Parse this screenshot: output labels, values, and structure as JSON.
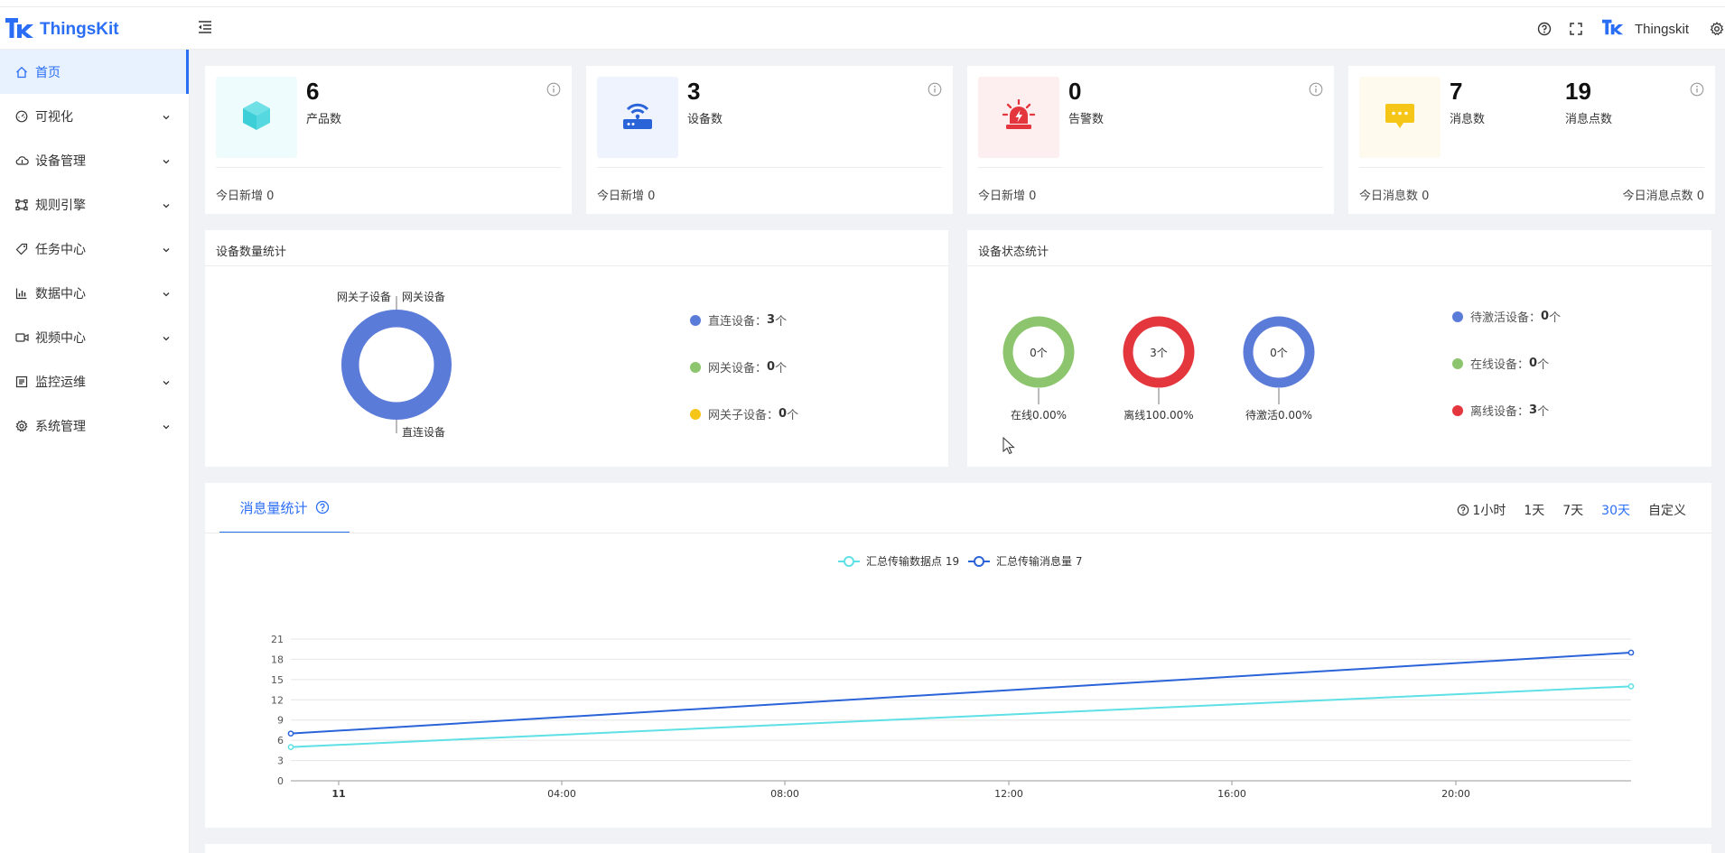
{
  "app": {
    "logo_text": "ThingsKit"
  },
  "header": {
    "user_name": "Thingskit"
  },
  "sidebar": {
    "items": [
      {
        "label": "首页",
        "icon": "home-icon"
      },
      {
        "label": "可视化",
        "icon": "dashboard-icon"
      },
      {
        "label": "设备管理",
        "icon": "cloud-icon"
      },
      {
        "label": "规则引擎",
        "icon": "flow-icon"
      },
      {
        "label": "任务中心",
        "icon": "tag-icon"
      },
      {
        "label": "数据中心",
        "icon": "bar-chart-icon"
      },
      {
        "label": "视频中心",
        "icon": "video-icon"
      },
      {
        "label": "监控运维",
        "icon": "monitor-icon"
      },
      {
        "label": "系统管理",
        "icon": "gear-icon"
      }
    ]
  },
  "stats": {
    "products": {
      "value": "6",
      "label": "产品数",
      "foot": "今日新增 0",
      "color": "#eefcfd"
    },
    "devices": {
      "value": "3",
      "label": "设备数",
      "foot": "今日新增 0",
      "color": "#eef3fe"
    },
    "alarms": {
      "value": "0",
      "label": "告警数",
      "foot": "今日新增 0",
      "color": "#fdeff0"
    },
    "messages": {
      "value": "7",
      "label": "消息数",
      "value2": "19",
      "label2": "消息点数",
      "foot": "今日消息数 0",
      "foot2": "今日消息点数 0",
      "color": "#fefaee"
    }
  },
  "device_count": {
    "title": "设备数量统计",
    "donut_labels": {
      "gateway_sub": "网关子设备",
      "gateway": "网关设备",
      "direct": "直连设备"
    },
    "legend": [
      {
        "name": "直连设备：",
        "value": "3",
        "unit": "个",
        "color": "#5b7bd9"
      },
      {
        "name": "网关设备：",
        "value": "0",
        "unit": "个",
        "color": "#8cc56d"
      },
      {
        "name": "网关子设备：",
        "value": "0",
        "unit": "个",
        "color": "#f5c518"
      }
    ]
  },
  "device_status": {
    "title": "设备状态统计",
    "gauges": [
      {
        "center": "0个",
        "caption": "在线0.00%",
        "color": "#8cc56d"
      },
      {
        "center": "3个",
        "caption": "离线100.00%",
        "color": "#e3363d"
      },
      {
        "center": "0个",
        "caption": "待激活0.00%",
        "color": "#5b7bd9"
      }
    ],
    "legend": [
      {
        "name": "待激活设备：",
        "value": "0",
        "unit": "个",
        "color": "#5b7bd9"
      },
      {
        "name": "在线设备：",
        "value": "0",
        "unit": "个",
        "color": "#8cc56d"
      },
      {
        "name": "离线设备：",
        "value": "3",
        "unit": "个",
        "color": "#e3363d"
      }
    ]
  },
  "message_stats": {
    "tab_label": "消息量统计",
    "ranges": [
      "1小时",
      "1天",
      "7天",
      "30天",
      "自定义"
    ],
    "selected_range": "30天"
  },
  "chart_data": {
    "type": "line",
    "x": [
      "11",
      "04:00",
      "08:00",
      "12:00",
      "16:00",
      "20:00"
    ],
    "ylim": [
      0,
      21
    ],
    "yticks": [
      0,
      3,
      6,
      9,
      12,
      15,
      18,
      21
    ],
    "grid": true,
    "legend_position": "top-center",
    "series": [
      {
        "name": "汇总传输数据点 19",
        "color": "#5ee0e6",
        "points": [
          [
            0,
            5
          ],
          [
            1,
            14
          ]
        ]
      },
      {
        "name": "汇总传输消息量 7",
        "color": "#2b63d9",
        "points": [
          [
            0,
            7
          ],
          [
            1,
            19
          ]
        ]
      }
    ]
  }
}
